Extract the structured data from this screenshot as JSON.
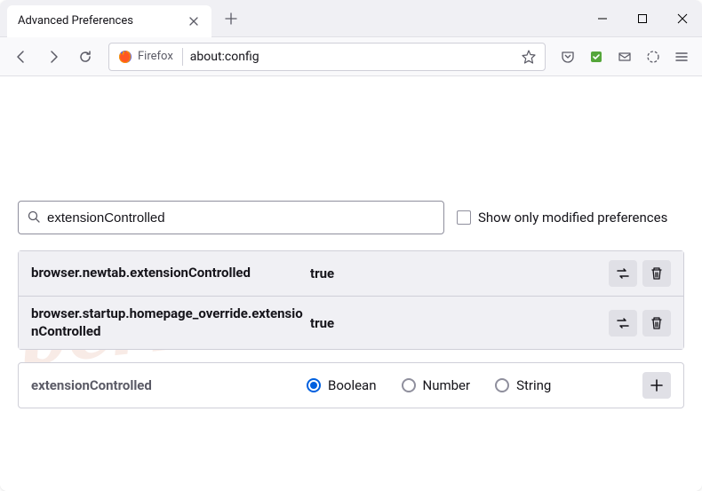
{
  "window": {
    "tab_title": "Advanced Preferences"
  },
  "urlbar": {
    "identity_label": "Firefox",
    "url": "about:config"
  },
  "search": {
    "value": "extensionControlled",
    "modified_label": "Show only modified preferences"
  },
  "prefs": [
    {
      "name": "browser.newtab.extensionControlled",
      "value": "true"
    },
    {
      "name": "browser.startup.homepage_override.extensionControlled",
      "value": "true"
    }
  ],
  "new_pref": {
    "name": "extensionControlled",
    "types": {
      "boolean": "Boolean",
      "number": "Number",
      "string": "String"
    }
  },
  "watermark": "pcrisk.com"
}
